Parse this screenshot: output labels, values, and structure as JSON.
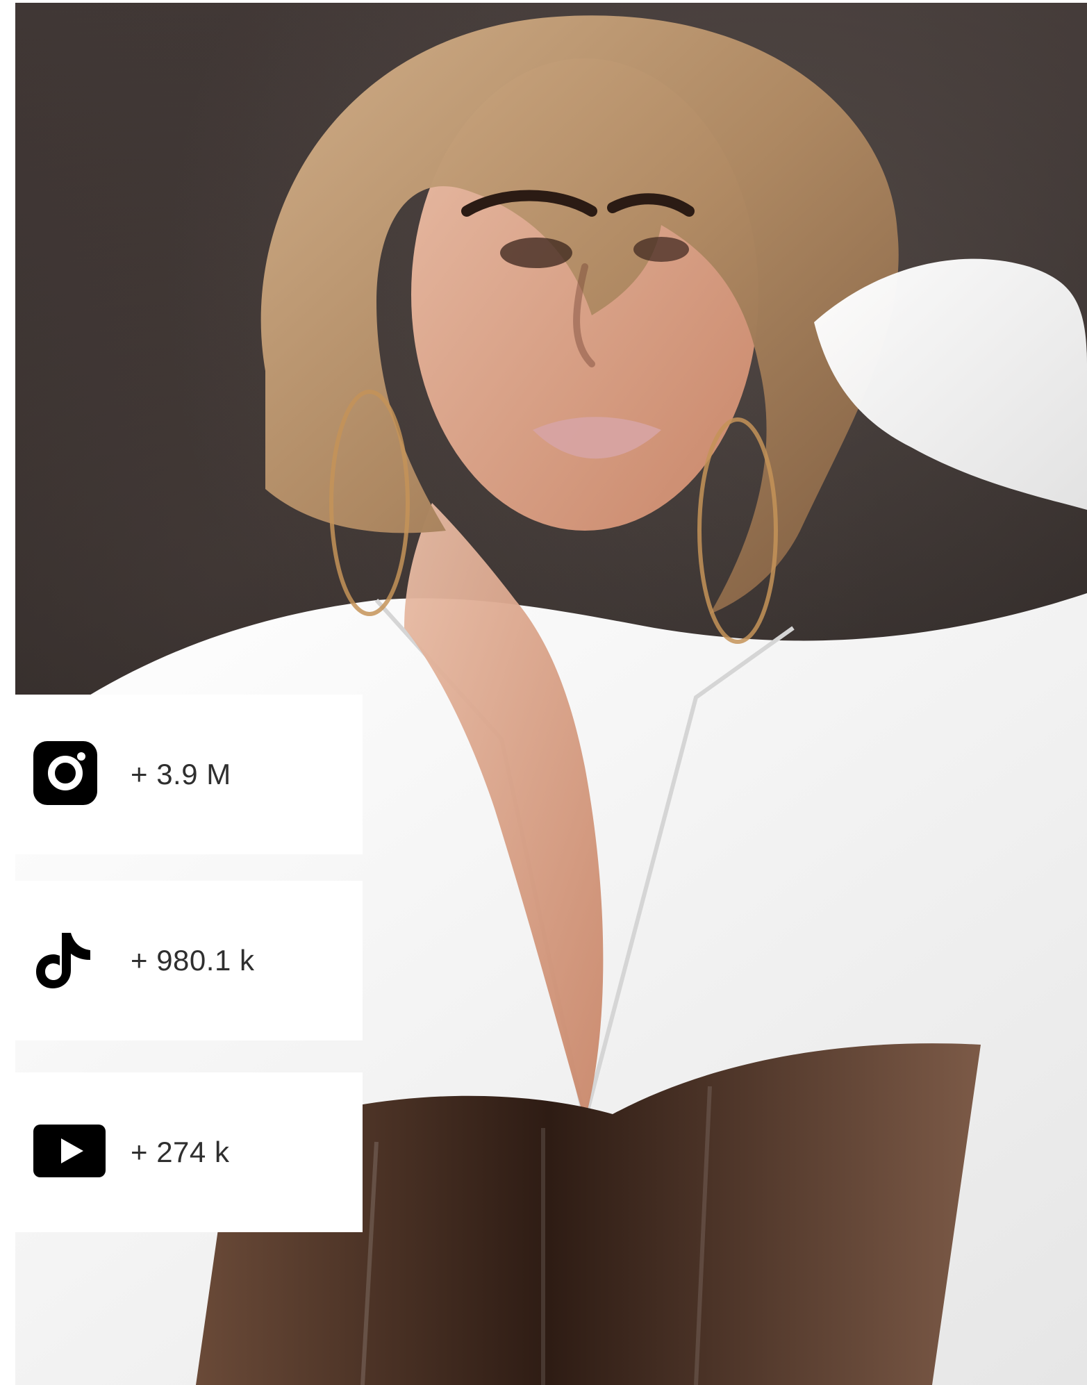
{
  "stats": {
    "instagram": {
      "icon": "instagram-icon",
      "count": "+ 3.9 M"
    },
    "tiktok": {
      "icon": "tiktok-icon",
      "count": "+ 980.1 k"
    },
    "youtube": {
      "icon": "youtube-icon",
      "count": "+ 274 k"
    }
  },
  "colors": {
    "card_background": "#ffffff",
    "text": "#2f2f2f",
    "icon": "#000000",
    "backdrop": "#2c2624",
    "hair": "#b08a63",
    "skin": "#d9a48a",
    "shirt": "#f3f3f3",
    "corset": "#4a2f21"
  }
}
